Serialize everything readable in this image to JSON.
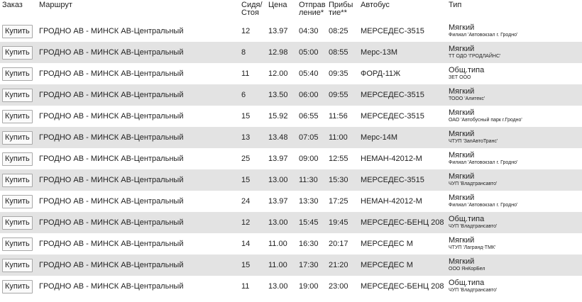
{
  "header": {
    "order": "Заказ",
    "route": "Маршрут",
    "seats": "Сидя/ Стоя",
    "price": "Цена",
    "departure": "Отправ ление*",
    "arrival": "Прибы тие**",
    "bus": "Автобус",
    "type": "Тип"
  },
  "buy_label": "Купить",
  "rows": [
    {
      "route": "ГРОДНО АВ - МИНСК АВ-Центральный",
      "seats": "12",
      "price": "13.97",
      "dep": "04:30",
      "arr": "08:25",
      "bus": "МЕРСЕДЕС-3515",
      "type": "Мягкий",
      "carrier": "Филиал 'Автовокзал г. Гродно'"
    },
    {
      "route": "ГРОДНО АВ - МИНСК АВ-Центральный",
      "seats": "8",
      "price": "12.98",
      "dep": "05:00",
      "arr": "08:55",
      "bus": "Мерс-13М",
      "type": "Мягкий",
      "carrier": "ТТ ОДО 'ГРОДЛАЙНС'"
    },
    {
      "route": "ГРОДНО АВ - МИНСК АВ-Центральный",
      "seats": "11",
      "price": "12.00",
      "dep": "05:40",
      "arr": "09:35",
      "bus": "ФОРД-11Ж",
      "type": "Общ.типа",
      "carrier": "ЗЕТ ООО"
    },
    {
      "route": "ГРОДНО АВ - МИНСК АВ-Центральный",
      "seats": "6",
      "price": "13.50",
      "dep": "06:00",
      "arr": "09:55",
      "bus": "МЕРСЕДЕС-3515",
      "type": "Мягкий",
      "carrier": "ТООО 'Алитекс'"
    },
    {
      "route": "ГРОДНО АВ - МИНСК АВ-Центральный",
      "seats": "15",
      "price": "15.92",
      "dep": "06:55",
      "arr": "11:56",
      "bus": "МЕРСЕДЕС-3515",
      "type": "Мягкий",
      "carrier": "ОАО 'Автобусный парк г.Гродно'"
    },
    {
      "route": "ГРОДНО АВ - МИНСК АВ-Центральный",
      "seats": "13",
      "price": "13.48",
      "dep": "07:05",
      "arr": "11:00",
      "bus": "Мерс-14М",
      "type": "Мягкий",
      "carrier": "ЧТУП 'ЗапАвтоТранс'"
    },
    {
      "route": "ГРОДНО АВ - МИНСК АВ-Центральный",
      "seats": "25",
      "price": "13.97",
      "dep": "09:00",
      "arr": "12:55",
      "bus": "НЕМАН-42012-М",
      "type": "Мягкий",
      "carrier": "Филиал 'Автовокзал г. Гродно'"
    },
    {
      "route": "ГРОДНО АВ - МИНСК АВ-Центральный",
      "seats": "15",
      "price": "13.00",
      "dep": "11:30",
      "arr": "15:30",
      "bus": "МЕРСЕДЕС-3515",
      "type": "Мягкий",
      "carrier": "ЧУП 'Владтрансавто'"
    },
    {
      "route": "ГРОДНО АВ - МИНСК АВ-Центральный",
      "seats": "24",
      "price": "13.97",
      "dep": "13:30",
      "arr": "17:25",
      "bus": "НЕМАН-42012-М",
      "type": "Мягкий",
      "carrier": "Филиал 'Автовокзал г. Гродно'"
    },
    {
      "route": "ГРОДНО АВ - МИНСК АВ-Центральный",
      "seats": "12",
      "price": "13.00",
      "dep": "15:45",
      "arr": "19:45",
      "bus": "МЕРСЕДЕС-БЕНЦ 208",
      "type": "Общ.типа",
      "carrier": "ЧУП 'Владтрансавто'"
    },
    {
      "route": "ГРОДНО АВ - МИНСК АВ-Центральный",
      "seats": "14",
      "price": "11.00",
      "dep": "16:30",
      "arr": "20:17",
      "bus": "МЕРСЕДЕС М",
      "type": "Мягкий",
      "carrier": "ЧТУП 'Лагранд-ТМК'"
    },
    {
      "route": "ГРОДНО АВ - МИНСК АВ-Центральный",
      "seats": "15",
      "price": "11.00",
      "dep": "17:30",
      "arr": "21:20",
      "bus": "МЕРСЕДЕС М",
      "type": "Мягкий",
      "carrier": "ООО ЯнКорБел"
    },
    {
      "route": "ГРОДНО АВ - МИНСК АВ-Центральный",
      "seats": "11",
      "price": "13.00",
      "dep": "19:00",
      "arr": "23:00",
      "bus": "МЕРСЕДЕС-БЕНЦ 208",
      "type": "Общ.типа",
      "carrier": "ЧУП 'Владтрансавто'"
    }
  ]
}
